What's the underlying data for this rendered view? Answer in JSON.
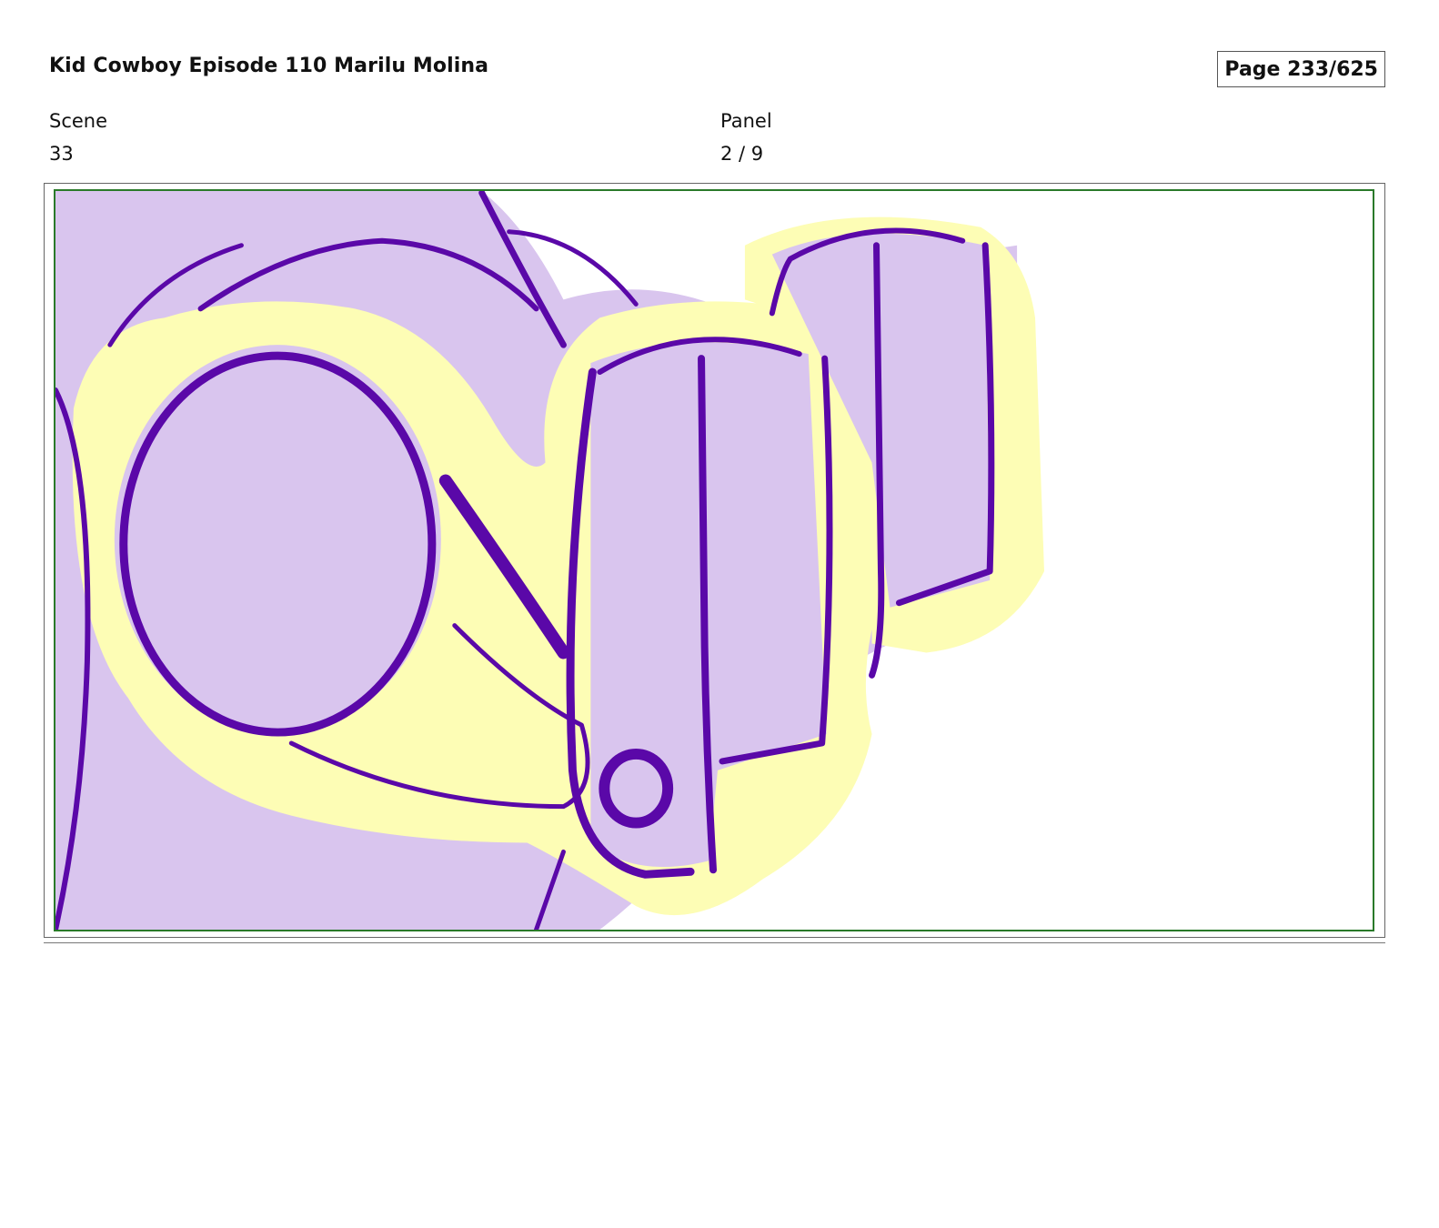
{
  "header": {
    "title": "Kid Cowboy Episode 110 Marilu Molina",
    "page": "Page 233/625"
  },
  "meta": {
    "scene_label": "Scene",
    "scene_value": "33",
    "panel_label": "Panel",
    "panel_value": "2 / 9"
  },
  "panel": {
    "drawing": "sketch-fist-pointing",
    "colors": {
      "fill": "#d9c5ee",
      "line": "#5a08a8",
      "highlight": "#fdfdb5",
      "frame": "#2a7a2a"
    }
  }
}
